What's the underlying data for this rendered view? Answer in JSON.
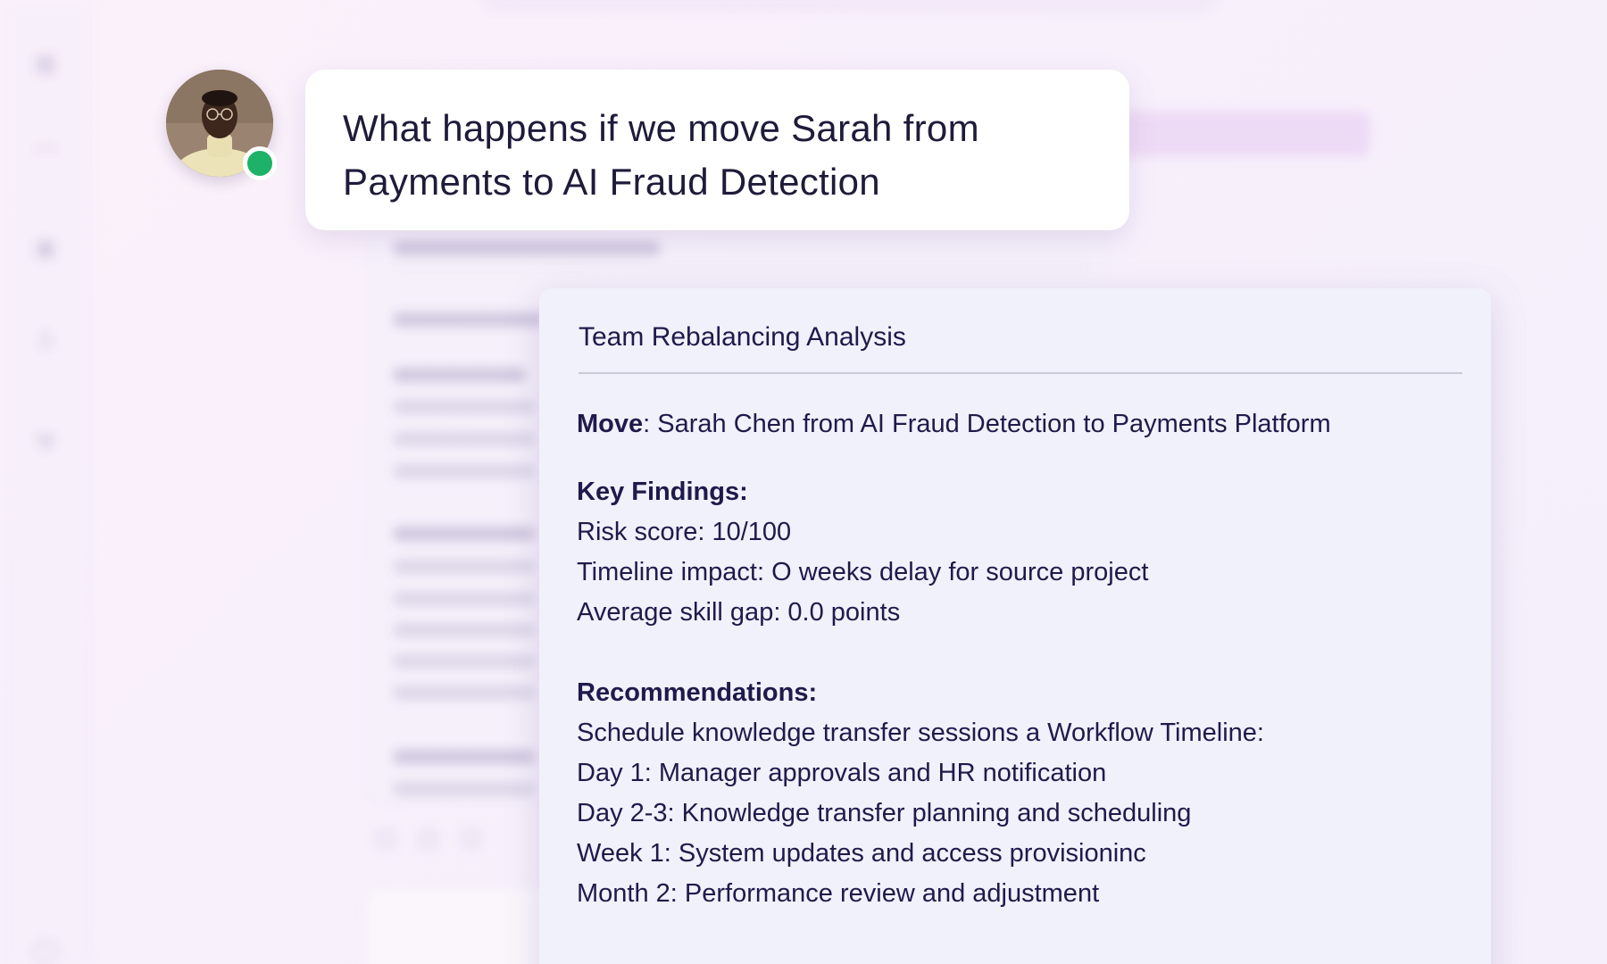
{
  "chat": {
    "user_message": "What happens if we move Sarah from Payments to AI Fraud Detection"
  },
  "analysis": {
    "title": "Team Rebalancing Analysis",
    "move_label": "Move",
    "move_value": ": Sarah Chen from AI Fraud Detection to Payments Platform",
    "key_findings_heading": "Key Findings:",
    "key_findings": [
      "Risk score: 10/100",
      "Timeline impact: O weeks delay for source project",
      "Average skill gap: 0.0 points"
    ],
    "recommendations_heading": "Recommendations:",
    "recommendations": [
      "Schedule knowledge transfer sessions a Workflow Timeline:",
      "Day 1: Manager approvals and HR notification",
      "Day 2-3: Knowledge transfer planning and scheduling",
      "Week 1: System updates and access provisioninc",
      "Month 2: Performance review and adjustment"
    ]
  },
  "sidebar": {
    "icons": [
      "grid-icon",
      "team-icon",
      "briefcase-icon",
      "user-plus-icon",
      "wrench-icon",
      "help-icon",
      "settings-icon"
    ]
  },
  "colors": {
    "background": "#f8f0fb",
    "card_background": "#f0f1fb",
    "text": "#1e1b4b",
    "status_online": "#1db267",
    "bubble": "#ffffff"
  }
}
